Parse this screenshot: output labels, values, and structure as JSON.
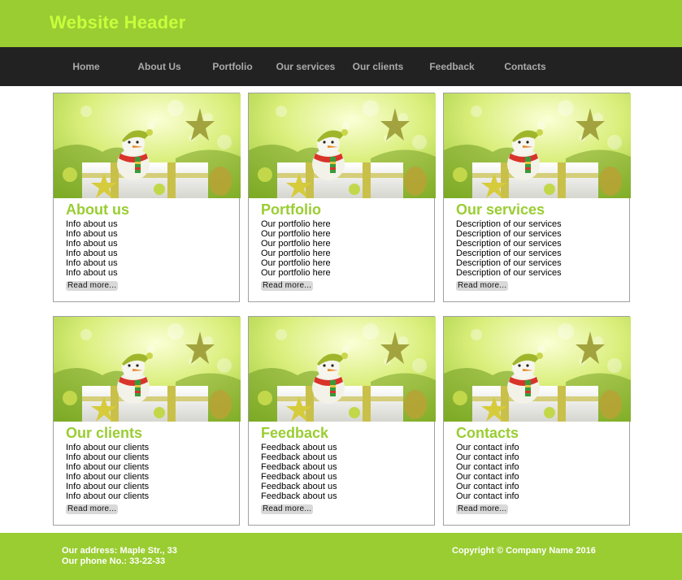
{
  "header": {
    "title": "Website Header"
  },
  "nav": {
    "items": [
      {
        "label": "Home"
      },
      {
        "label": "About Us"
      },
      {
        "label": "Portfolio"
      },
      {
        "label": "Our services"
      },
      {
        "label": "Our clients"
      },
      {
        "label": "Feedback"
      },
      {
        "label": "Contacts"
      }
    ]
  },
  "cards": [
    {
      "title": "About us",
      "lines": [
        "Info about us",
        "Info about us",
        "Info about us",
        "Info about us",
        "Info about us",
        "Info about us"
      ],
      "more": "Read more..."
    },
    {
      "title": "Portfolio",
      "lines": [
        "Our portfolio here",
        "Our portfolio here",
        "Our portfolio here",
        "Our portfolio here",
        "Our portfolio here",
        "Our portfolio here"
      ],
      "more": "Read more..."
    },
    {
      "title": "Our services",
      "lines": [
        "Description of our services",
        "Description of our services",
        "Description of our services",
        "Description of our services",
        "Description of our services",
        "Description of our services"
      ],
      "more": "Read more..."
    },
    {
      "title": "Our clients",
      "lines": [
        "Info about our clients",
        "Info about our clients",
        "Info about our clients",
        "Info about our clients",
        "Info about our clients",
        "Info about our clients"
      ],
      "more": "Read more..."
    },
    {
      "title": "Feedback",
      "lines": [
        "Feedback about us",
        "Feedback about us",
        "Feedback about us",
        "Feedback about us",
        "Feedback about us",
        "Feedback about us"
      ],
      "more": "Read more..."
    },
    {
      "title": "Contacts",
      "lines": [
        "Our contact info",
        "Our contact info",
        "Our contact info",
        "Our contact info",
        "Our contact info",
        "Our contact info"
      ],
      "more": "Read more..."
    }
  ],
  "footer": {
    "address": "Our address: Maple Str., 33",
    "phone": "Our phone No.: 33-22-33",
    "copyright": "Copyright © Company Name 2016"
  },
  "colors": {
    "accent": "#9acd32",
    "header_title": "#c8ff3c",
    "nav_bg": "#222222",
    "nav_text": "#aaaaaa"
  }
}
